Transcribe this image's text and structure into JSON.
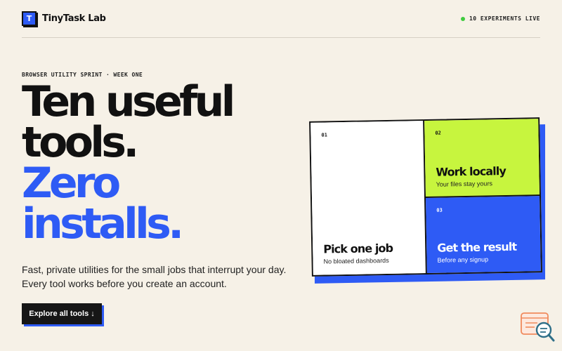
{
  "header": {
    "logo_letter": "T",
    "brand": "TinyTask Lab",
    "status": "10 EXPERIMENTS LIVE",
    "status_color": "#3fcb3f"
  },
  "hero": {
    "eyebrow": "BROWSER UTILITY SPRINT · WEEK ONE",
    "headline_lines": [
      "Ten useful",
      "tools.",
      "Zero",
      "installs."
    ],
    "subtext_lines": [
      "Fast, private utilities for the small jobs that interrupt your day.",
      "Every tool works before you create an account."
    ],
    "cta_label": "Explore all tools ↓"
  },
  "features": [
    {
      "num": "01",
      "title": "Pick one job",
      "desc": "No bloated dashboards"
    },
    {
      "num": "02",
      "title": "Work locally",
      "desc": "Your files stay yours"
    },
    {
      "num": "03",
      "title": "Get the result",
      "desc": "Before any signup"
    }
  ],
  "colors": {
    "background": "#f6f1e7",
    "accent_blue": "#2e5bf5",
    "accent_lime": "#c7f53e",
    "ink": "#111111"
  },
  "icons": {
    "corner_widget": "search-chat-icon"
  }
}
